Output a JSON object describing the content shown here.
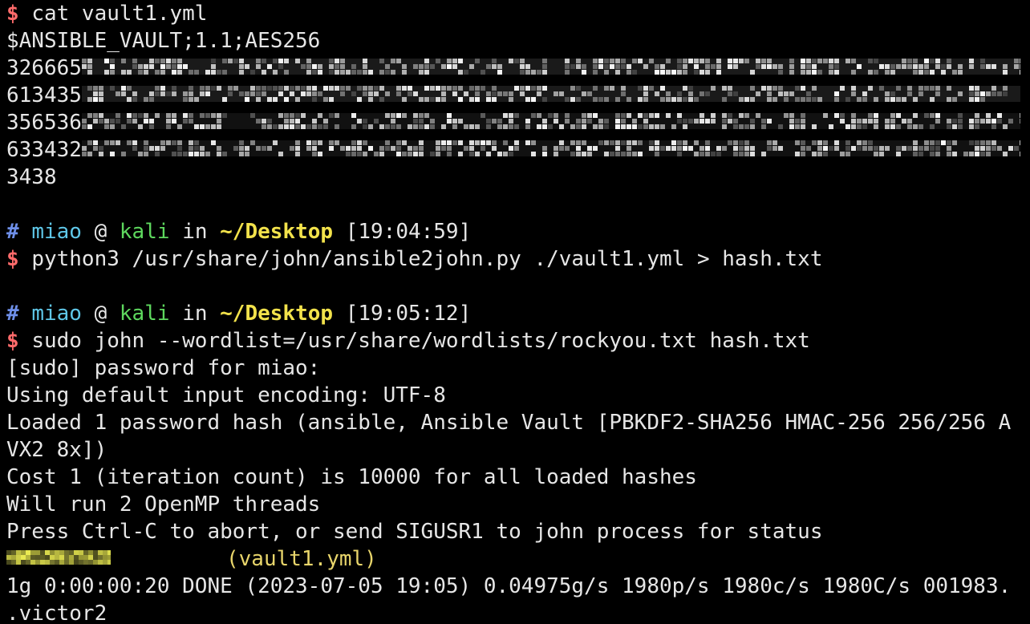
{
  "colors": {
    "background": "#000000",
    "text": "#e6e6e6",
    "dollar": "#ff6b6b",
    "hash": "#6e8fe8",
    "user": "#5fc7e8",
    "host": "#5ed85e",
    "path": "#f2e24b"
  },
  "lines": {
    "l0_cmd": "cat vault1.yml",
    "l1": "$ANSIBLE_VAULT;1.1;AES256",
    "l2_prefix": "326665",
    "l3_prefix": "613435",
    "l4_prefix": "356536",
    "l5_prefix": "633432",
    "l6": "3438",
    "l8_user": "miao",
    "l8_at": "@",
    "l8_host": "kali",
    "l8_in": "in",
    "l8_path": "~/Desktop",
    "l8_time": "[19:04:59]",
    "l9_cmd": "python3 /usr/share/john/ansible2john.py ./vault1.yml > hash.txt",
    "l11_user": "miao",
    "l11_at": "@",
    "l11_host": "kali",
    "l11_in": "in",
    "l11_path": "~/Desktop",
    "l11_time": "[19:05:12]",
    "l12_cmd": "sudo john --wordlist=/usr/share/wordlists/rockyou.txt hash.txt",
    "l13": "[sudo] password for miao:",
    "l14": "Using default input encoding: UTF-8",
    "l15": "Loaded 1 password hash (ansible, Ansible Vault [PBKDF2-SHA256 HMAC-256 256/256 A",
    "l16": "VX2 8x])",
    "l17": "Cost 1 (iteration count) is 10000 for all loaded hashes",
    "l18": "Will run 2 OpenMP threads",
    "l19": "Press Ctrl-C to abort, or send SIGUSR1 to john process for status",
    "l20_file": "(vault1.yml)",
    "l21": "1g 0:00:00:20 DONE (2023-07-05 19:05) 0.04975g/s 1980p/s 1980c/s 1980C/s 001983.",
    "l22": ".victor2"
  }
}
